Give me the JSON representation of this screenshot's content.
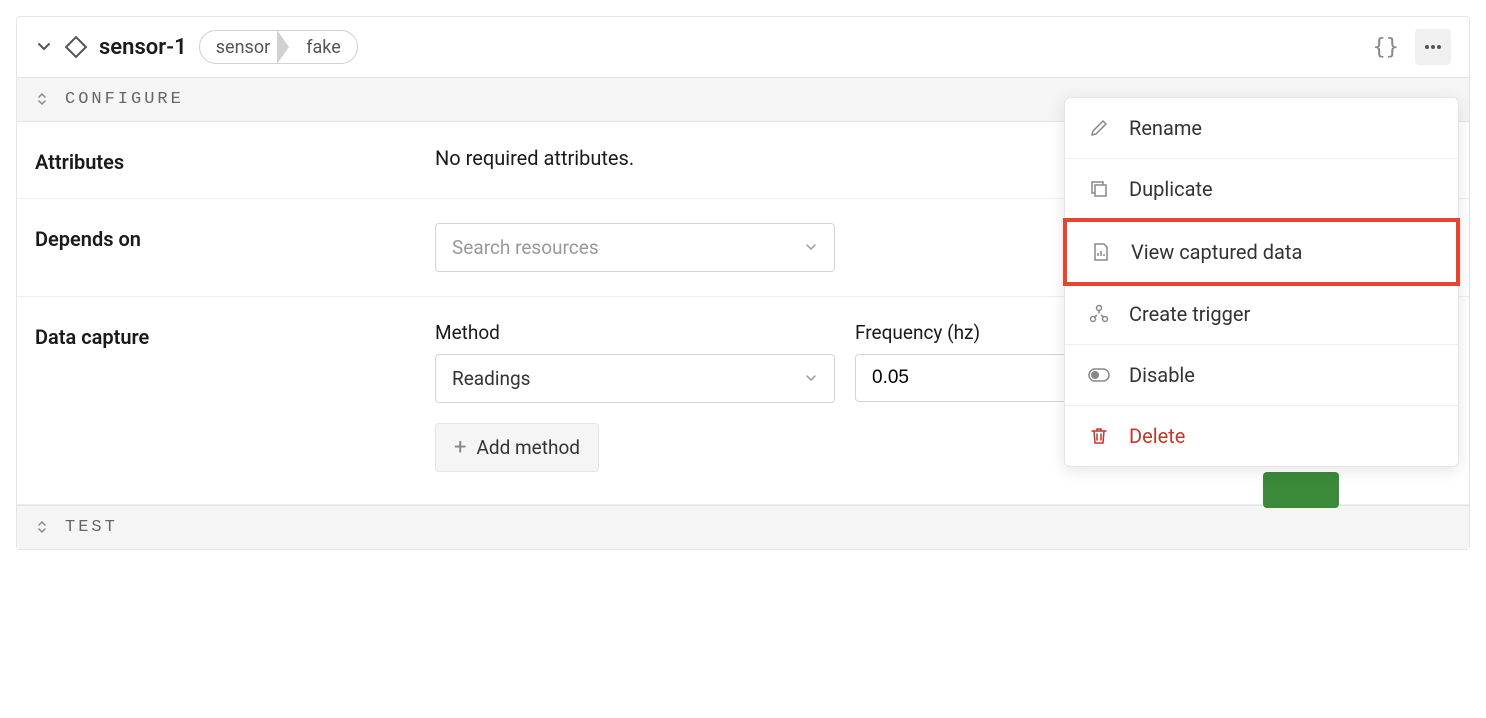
{
  "header": {
    "name": "sensor-1",
    "tags": [
      "sensor",
      "fake"
    ]
  },
  "sections": {
    "configure": {
      "title": "CONFIGURE"
    },
    "test": {
      "title": "TEST"
    }
  },
  "attributes": {
    "label": "Attributes",
    "value": "No required attributes."
  },
  "depends_on": {
    "label": "Depends on",
    "placeholder": "Search resources"
  },
  "data_capture": {
    "label": "Data capture",
    "method_label": "Method",
    "method_value": "Readings",
    "frequency_label": "Frequency (hz)",
    "frequency_value": "0.05",
    "add_button": "Add method"
  },
  "menu": {
    "rename": "Rename",
    "duplicate": "Duplicate",
    "view_data": "View captured data",
    "create_trigger": "Create trigger",
    "disable": "Disable",
    "delete": "Delete"
  }
}
